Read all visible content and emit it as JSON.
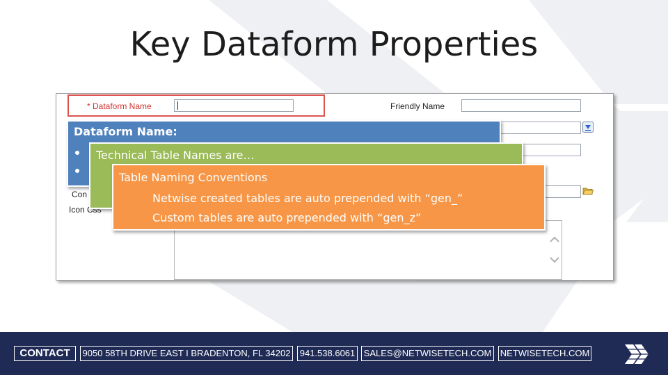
{
  "slide": {
    "title": "Key Dataform Properties"
  },
  "form": {
    "dataform_name_label": "* Dataform Name",
    "friendly_name_label": "Friendly Name",
    "partial_label_1": "Con",
    "partial_label_2": "Icon Css"
  },
  "callouts": {
    "dataform_name": {
      "title": "Dataform Name:"
    },
    "technical_table": {
      "title": "Technical Table Names are…"
    },
    "naming_conventions": {
      "title": "Table Naming Conventions",
      "lines": [
        "Netwise created tables are auto prepended with “gen_”",
        "Custom tables are auto prepended with “gen_z”"
      ]
    }
  },
  "footer": {
    "contact_label": "CONTACT",
    "address": "9050 58TH DRIVE EAST I BRADENTON, FL 34202",
    "phone": "941.538.6061",
    "email": "SALES@NETWISETECH.COM",
    "website": "NETWISETECH.COM"
  },
  "colors": {
    "callout_blue": "#4f81bd",
    "callout_green": "#9bbb59",
    "callout_orange": "#f79646",
    "footer_navy": "#1f2a55",
    "highlight_red": "#d9534f"
  },
  "icons": [
    "lookup-arrow-icon",
    "folder-icon",
    "scroll-up-icon",
    "scroll-down-icon",
    "netwise-logo-icon"
  ]
}
